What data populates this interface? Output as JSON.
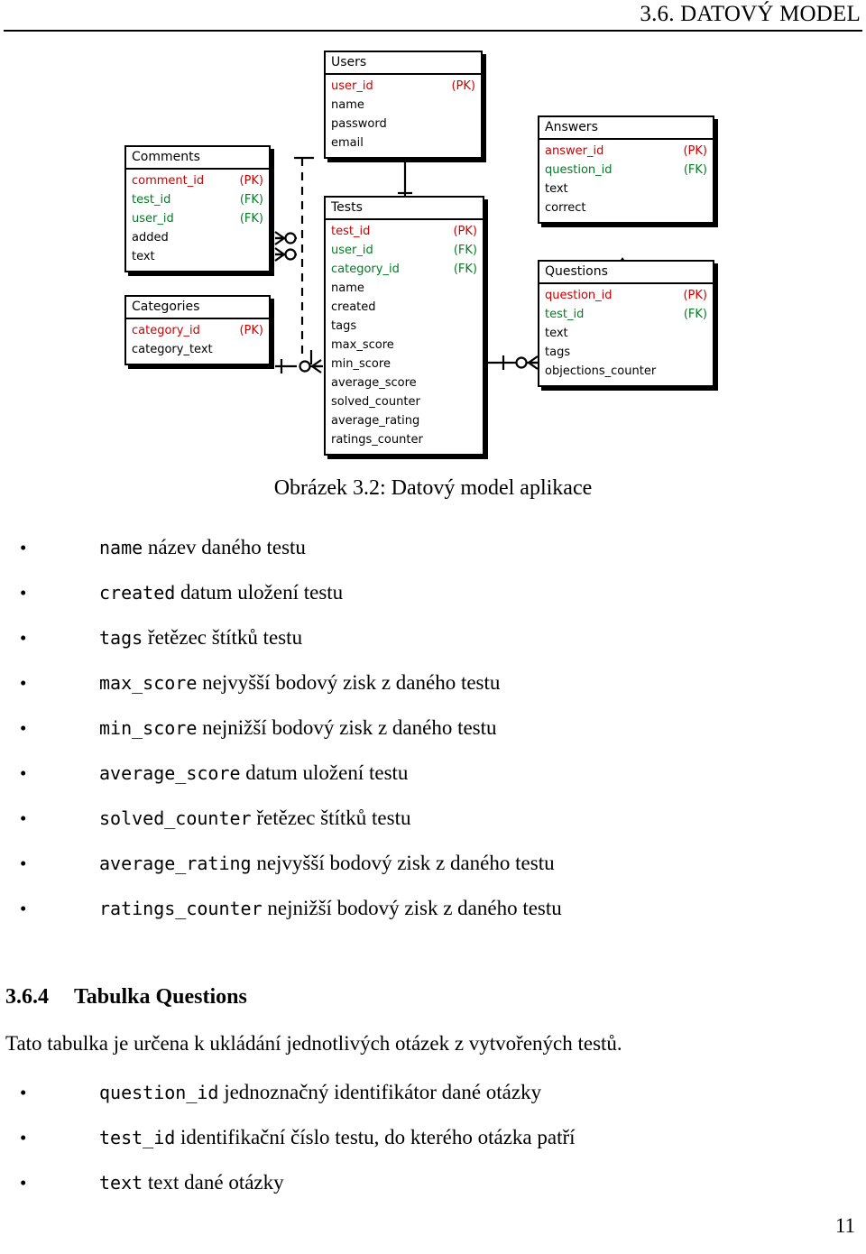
{
  "header": {
    "title": "3.6. DATOVÝ MODEL"
  },
  "figure": {
    "caption": "Obrázek 3.2: Datový model aplikace",
    "entities": [
      {
        "name": "Users",
        "fields": [
          {
            "name": "user_id",
            "key": "(PK)",
            "kind": "pk"
          },
          {
            "name": "name",
            "key": "",
            "kind": "plain"
          },
          {
            "name": "password",
            "key": "",
            "kind": "plain"
          },
          {
            "name": "email",
            "key": "",
            "kind": "plain"
          }
        ]
      },
      {
        "name": "Comments",
        "fields": [
          {
            "name": "comment_id",
            "key": "(PK)",
            "kind": "pk"
          },
          {
            "name": "test_id",
            "key": "(FK)",
            "kind": "fk"
          },
          {
            "name": "user_id",
            "key": "(FK)",
            "kind": "fk"
          },
          {
            "name": "added",
            "key": "",
            "kind": "plain"
          },
          {
            "name": "text",
            "key": "",
            "kind": "plain"
          }
        ]
      },
      {
        "name": "Categories",
        "fields": [
          {
            "name": "category_id",
            "key": "(PK)",
            "kind": "pk"
          },
          {
            "name": "category_text",
            "key": "",
            "kind": "plain"
          }
        ]
      },
      {
        "name": "Tests",
        "fields": [
          {
            "name": "test_id",
            "key": "(PK)",
            "kind": "pk"
          },
          {
            "name": "user_id",
            "key": "(FK)",
            "kind": "fk"
          },
          {
            "name": "category_id",
            "key": "(FK)",
            "kind": "fk"
          },
          {
            "name": "name",
            "key": "",
            "kind": "plain"
          },
          {
            "name": "created",
            "key": "",
            "kind": "plain"
          },
          {
            "name": "tags",
            "key": "",
            "kind": "plain"
          },
          {
            "name": "max_score",
            "key": "",
            "kind": "plain"
          },
          {
            "name": "min_score",
            "key": "",
            "kind": "plain"
          },
          {
            "name": "average_score",
            "key": "",
            "kind": "plain"
          },
          {
            "name": "solved_counter",
            "key": "",
            "kind": "plain"
          },
          {
            "name": "average_rating",
            "key": "",
            "kind": "plain"
          },
          {
            "name": "ratings_counter",
            "key": "",
            "kind": "plain"
          }
        ]
      },
      {
        "name": "Answers",
        "fields": [
          {
            "name": "answer_id",
            "key": "(PK)",
            "kind": "pk"
          },
          {
            "name": "question_id",
            "key": "(FK)",
            "kind": "fk"
          },
          {
            "name": "text",
            "key": "",
            "kind": "plain"
          },
          {
            "name": "correct",
            "key": "",
            "kind": "plain"
          }
        ]
      },
      {
        "name": "Questions",
        "fields": [
          {
            "name": "question_id",
            "key": "(PK)",
            "kind": "pk"
          },
          {
            "name": "test_id",
            "key": "(FK)",
            "kind": "fk"
          },
          {
            "name": "text",
            "key": "",
            "kind": "plain"
          },
          {
            "name": "tags",
            "key": "",
            "kind": "plain"
          },
          {
            "name": "objections_counter",
            "key": "",
            "kind": "plain"
          }
        ]
      }
    ],
    "colors": {
      "primary_key": "#cc0000",
      "foreign_key": "#007d23",
      "plain": "#000000",
      "border": "#000000"
    }
  },
  "bullets_tests": [
    {
      "code": "name",
      "desc": "název daného testu"
    },
    {
      "code": "created",
      "desc": "datum uložení testu"
    },
    {
      "code": "tags",
      "desc": "řetězec štítků testu"
    },
    {
      "code": "max_score",
      "desc": "nejvyšší bodový zisk z daného testu"
    },
    {
      "code": "min_score",
      "desc": "nejnižší bodový zisk z daného testu"
    },
    {
      "code": "average_score",
      "desc": "datum uložení testu"
    },
    {
      "code": "solved_counter",
      "desc": "řetězec štítků testu"
    },
    {
      "code": "average_rating",
      "desc": "nejvyšší bodový zisk z daného testu"
    },
    {
      "code": "ratings_counter",
      "desc": "nejnižší bodový zisk z daného testu"
    }
  ],
  "section": {
    "number": "3.6.4",
    "title": "Tabulka Questions",
    "paragraph": "Tato tabulka je určena k ukládání jednotlivých otázek z vytvořených testů."
  },
  "bullets_questions": [
    {
      "code": "question_id",
      "desc": "jednoznačný identifikátor dané otázky"
    },
    {
      "code": "test_id",
      "desc": "identifikační číslo testu, do kterého otázka patří"
    },
    {
      "code": "text",
      "desc": "text dané otázky"
    }
  ],
  "footer": {
    "page_number": "11"
  }
}
